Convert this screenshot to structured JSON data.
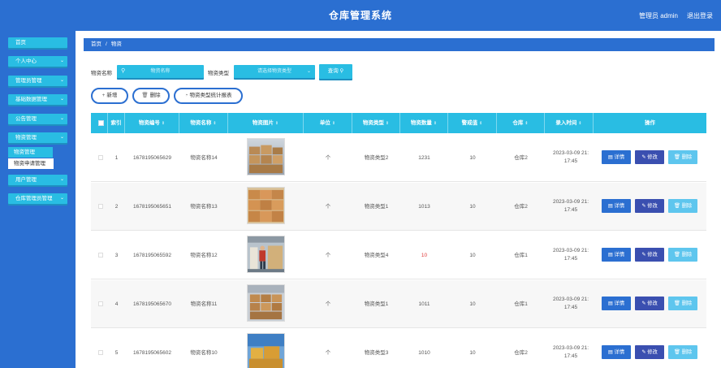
{
  "header": {
    "title": "仓库管理系统",
    "user": "管理员 admin",
    "logout": "退出登录"
  },
  "sidebar": {
    "items": [
      {
        "label": "首页"
      },
      {
        "label": "个人中心",
        "chevron": "⌄"
      },
      {
        "label": "管理员管理",
        "chevron": "⌄"
      },
      {
        "label": "基础数据管理",
        "chevron": "⌄"
      },
      {
        "label": "公告管理",
        "chevron": "⌄"
      },
      {
        "label": "物资管理",
        "chevron": "⌄"
      },
      {
        "label": "用户管理",
        "chevron": "⌄"
      },
      {
        "label": "仓库管理员管理",
        "chevron": "⌄"
      }
    ],
    "sub_items": [
      {
        "label": "物资管理"
      },
      {
        "label": "物资申请管理"
      }
    ]
  },
  "breadcrumb": {
    "home": "首页",
    "separator": "/",
    "current": "物资"
  },
  "search": {
    "name_label": "物资名称",
    "name_placeholder": "物资名称",
    "type_label": "物资类型",
    "type_placeholder": "请选择物资类型",
    "query_label": "查询"
  },
  "actions": {
    "add": "新增",
    "delete": "删除",
    "report": "物资类型统计报表"
  },
  "table": {
    "headers": [
      "索引",
      "物资编号",
      "物资名称",
      "物资图片",
      "单位",
      "物资类型",
      "物资数量",
      "警戒值",
      "仓库",
      "录入时间",
      "操作"
    ],
    "sort_glyph": "⇕",
    "rows": [
      {
        "index": "1",
        "code": "1678195065629",
        "name": "物资名称14",
        "unit": "个",
        "type": "物资类型2",
        "qty": "1231",
        "qty_alert": false,
        "warn": "10",
        "warehouse": "仓库2",
        "date": "2023-03-09 21:",
        "time": "17:45"
      },
      {
        "index": "2",
        "code": "1678195065651",
        "name": "物资名称13",
        "unit": "个",
        "type": "物资类型1",
        "qty": "1013",
        "qty_alert": false,
        "warn": "10",
        "warehouse": "仓库2",
        "date": "2023-03-09 21:",
        "time": "17:45"
      },
      {
        "index": "3",
        "code": "1678195065592",
        "name": "物资名称12",
        "unit": "个",
        "type": "物资类型4",
        "qty": "10",
        "qty_alert": true,
        "warn": "10",
        "warehouse": "仓库1",
        "date": "2023-03-09 21:",
        "time": "17:45"
      },
      {
        "index": "4",
        "code": "1678195065670",
        "name": "物资名称11",
        "unit": "个",
        "type": "物资类型1",
        "qty": "1011",
        "qty_alert": false,
        "warn": "10",
        "warehouse": "仓库1",
        "date": "2023-03-09 21:",
        "time": "17:45"
      },
      {
        "index": "5",
        "code": "1678195065602",
        "name": "物资名称10",
        "unit": "个",
        "type": "物资类型3",
        "qty": "1010",
        "qty_alert": false,
        "warn": "10",
        "warehouse": "仓库2",
        "date": "2023-03-09 21:",
        "time": "17:45"
      }
    ],
    "row_buttons": {
      "detail": "详情",
      "edit": "修改",
      "delete": "删除"
    }
  },
  "colors": {
    "primary": "#2b6fd1",
    "accent": "#29bde3",
    "alert": "#e03a3a"
  }
}
